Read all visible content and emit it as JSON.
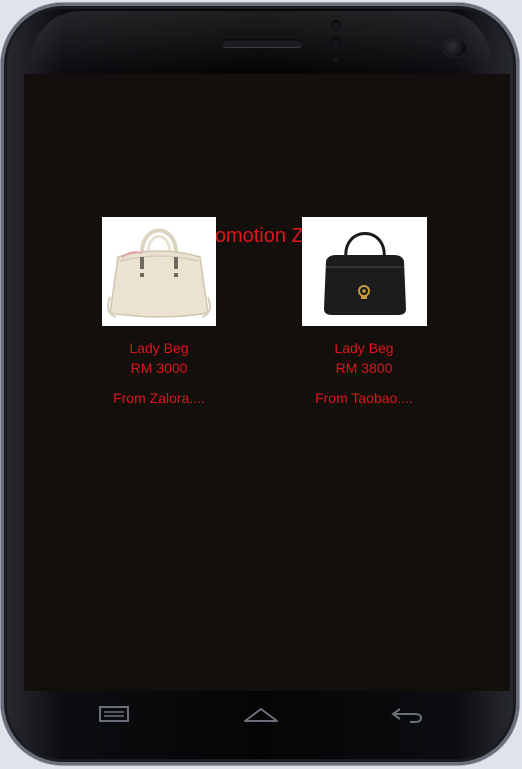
{
  "screen": {
    "title": "Promotion Zone",
    "products": [
      {
        "name": "Lady Beg",
        "price": "RM 3000",
        "source": "From Zalora....",
        "image": "cream-handbag"
      },
      {
        "name": "Lady Beg",
        "price": "RM 3800",
        "source": "From Taobao....",
        "image": "black-handbag"
      }
    ]
  },
  "navbar": {
    "icons": [
      "recent-apps-icon",
      "home-icon",
      "back-icon"
    ]
  },
  "colors": {
    "accent": "#e0141b",
    "screen_bg": "#120f0c"
  }
}
